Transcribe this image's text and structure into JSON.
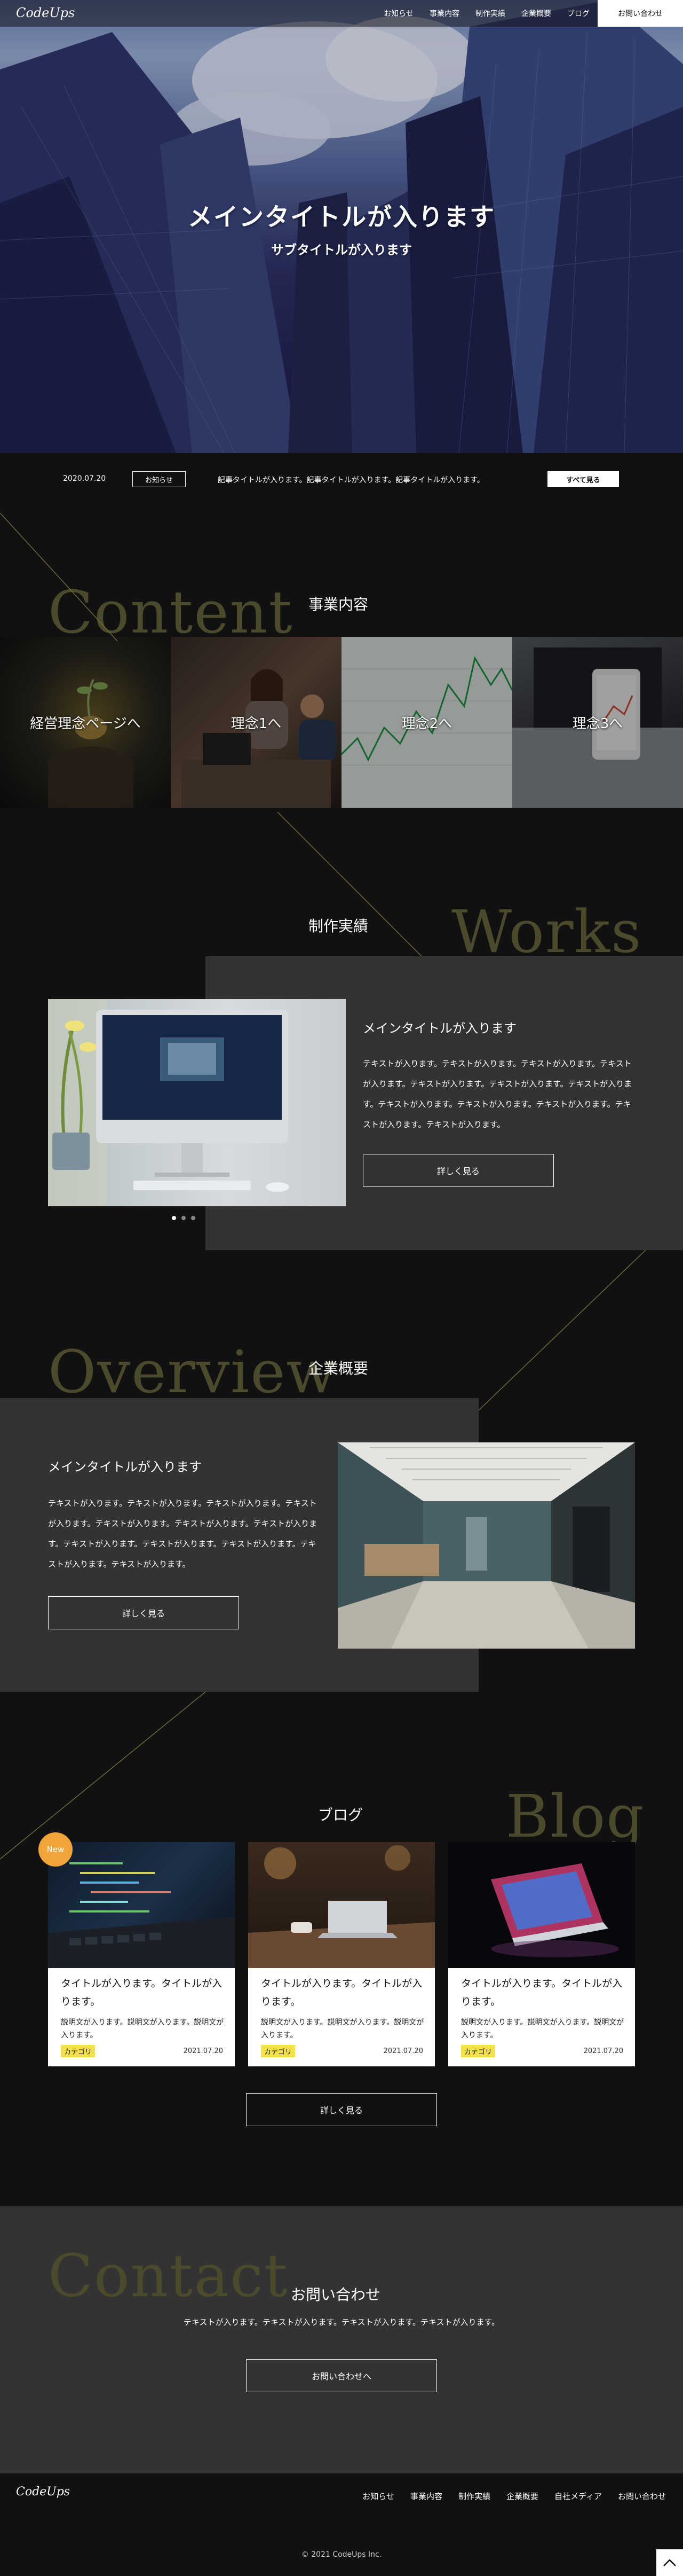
{
  "header": {
    "logo": "CodeUps",
    "nav": [
      "お知らせ",
      "事業内容",
      "制作実績",
      "企業概要",
      "ブログ"
    ],
    "contact_label": "お問い合わせ"
  },
  "hero": {
    "title": "メインタイトルが入ります",
    "subtitle": "サブタイトルが入ります"
  },
  "news": {
    "date": "2020.07.20",
    "tag": "お知らせ",
    "title": "記事タイトルが入ります。記事タイトルが入ります。記事タイトルが入ります。",
    "all_label": "すべて見る"
  },
  "content": {
    "bg_word": "Content",
    "title": "事業内容",
    "tiles": [
      "経営理念ページへ",
      "理念1へ",
      "理念2へ",
      "理念3へ"
    ]
  },
  "works": {
    "bg_word": "Works",
    "title": "制作実績",
    "card_title": "メインタイトルが入ります",
    "text": "テキストが入ります。テキストが入ります。テキストが入ります。テキストが入ります。テキストが入ります。テキストが入ります。テキストが入ります。テキストが入ります。テキストが入ります。テキストが入ります。テキストが入ります。テキストが入ります。",
    "button": "詳しく見る"
  },
  "overview": {
    "bg_word": "Overview",
    "title": "企業概要",
    "card_title": "メインタイトルが入ります",
    "text": "テキストが入ります。テキストが入ります。テキストが入ります。テキストが入ります。テキストが入ります。テキストが入ります。テキストが入ります。テキストが入ります。テキストが入ります。テキストが入ります。テキストが入ります。テキストが入ります。",
    "button": "詳しく見る"
  },
  "blog": {
    "bg_word": "Blog",
    "title": "ブログ",
    "new_badge": "New",
    "cards": [
      {
        "title": "タイトルが入ります。タイトルが入ります。",
        "desc": "説明文が入ります。説明文が入ります。説明文が入ります。",
        "category": "カテゴリ",
        "date": "2021.07.20"
      },
      {
        "title": "タイトルが入ります。タイトルが入ります。",
        "desc": "説明文が入ります。説明文が入ります。説明文が入ります。",
        "category": "カテゴリ",
        "date": "2021.07.20"
      },
      {
        "title": "タイトルが入ります。タイトルが入ります。",
        "desc": "説明文が入ります。説明文が入ります。説明文が入ります。",
        "category": "カテゴリ",
        "date": "2021.07.20"
      }
    ],
    "button": "詳しく見る"
  },
  "contact": {
    "bg_word": "Contact",
    "title": "お問い合わせ",
    "text": "テキストが入ります。テキストが入ります。テキストが入ります。テキストが入ります。",
    "button": "お問い合わせへ"
  },
  "footer": {
    "logo": "CodeUps",
    "nav": [
      "お知らせ",
      "事業内容",
      "制作実績",
      "企業概要",
      "自社メディア",
      "お問い合わせ"
    ],
    "copyright": "© 2021 CodeUps Inc."
  },
  "colors": {
    "background": "#111111",
    "panel": "#333333",
    "accent_gold": "#4c4a2d",
    "category_yellow": "#f5e14a",
    "new_badge": "#f0a43a"
  }
}
